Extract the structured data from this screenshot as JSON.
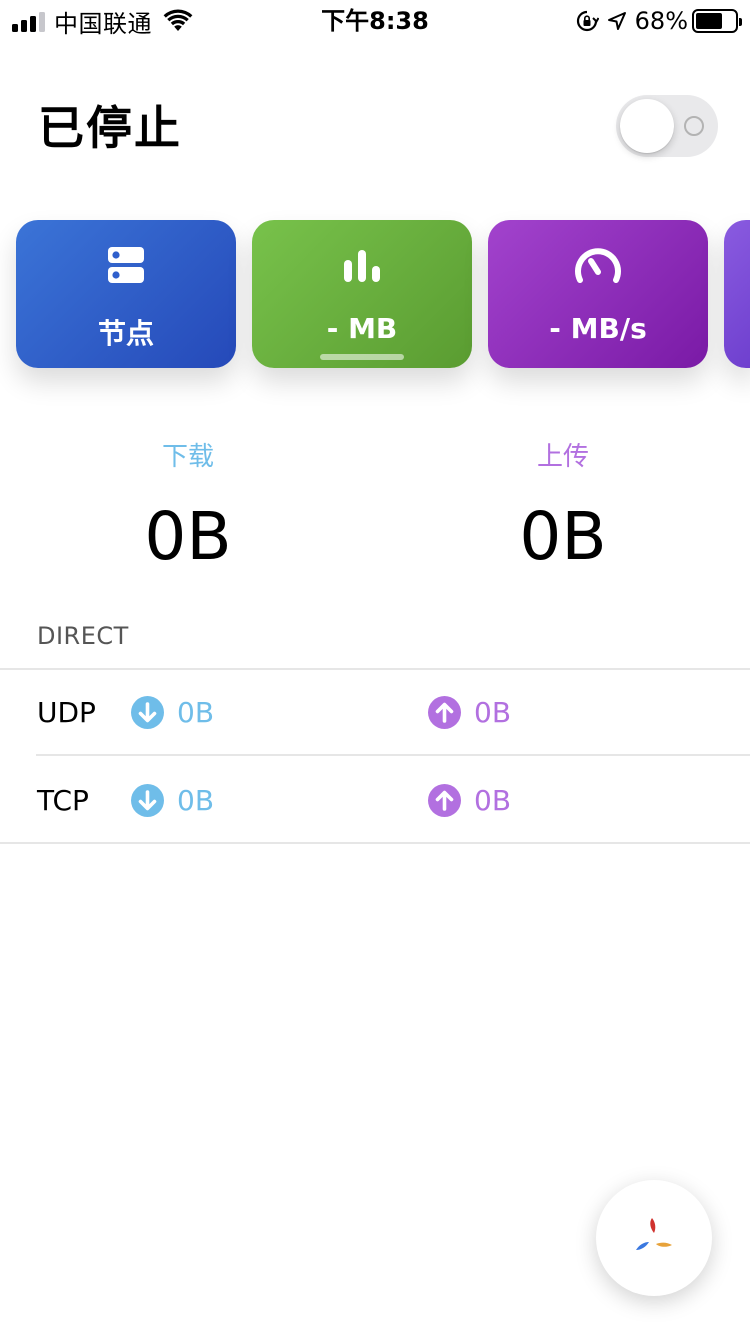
{
  "status_bar": {
    "carrier": "中国联通",
    "time": "下午8:38",
    "battery_percent": "68%",
    "battery_level": 0.68,
    "icons": [
      "cellular-signal-icon",
      "wifi-icon",
      "orientation-lock-icon",
      "location-arrow-icon",
      "battery-icon"
    ]
  },
  "header": {
    "title": "已停止",
    "toggle_state": "off"
  },
  "cards": {
    "nodes": {
      "label": "节点",
      "icon": "server-icon",
      "color": "#2f5fcc"
    },
    "traffic": {
      "label": "- MB",
      "icon": "bar-chart-icon",
      "color": "#67ad3c"
    },
    "speed": {
      "label": "- MB/s",
      "icon": "speedometer-icon",
      "color": "#8e2cbc"
    }
  },
  "totals": {
    "download_label": "下载",
    "upload_label": "上传",
    "download_value": "0B",
    "upload_value": "0B",
    "download_color": "#6fbde9",
    "upload_color": "#b270e0"
  },
  "direct": {
    "title": "DIRECT",
    "rows": [
      {
        "protocol": "UDP",
        "download": "0B",
        "upload": "0B"
      },
      {
        "protocol": "TCP",
        "download": "0B",
        "upload": "0B"
      }
    ]
  },
  "fab": {
    "icon": "pinwheel-icon"
  }
}
